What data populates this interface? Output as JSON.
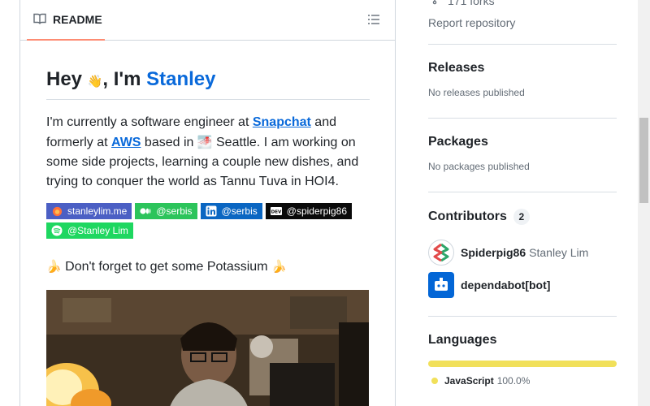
{
  "readme": {
    "tab_label": "README",
    "heading_prefix": "Hey ",
    "heading_emoji": "👋",
    "heading_mid": ", I'm ",
    "heading_name": "Stanley",
    "intro": {
      "t1": "I'm currently a software engineer at ",
      "snapchat": "Snapchat",
      "t2": " and formerly at ",
      "aws": "AWS",
      "t3": " based in ",
      "seattle_emoji": "🌁",
      "t4": " Seattle. I am working on some side projects, learning a couple new dishes, and trying to conquer the world as Tannu Tuva in HOI4."
    },
    "badges": [
      {
        "label": "stanleylim.me",
        "color": "#4b5fc4",
        "icon": "firefox-icon"
      },
      {
        "label": "@serbis",
        "color": "#2cc45b",
        "icon": "medium-icon"
      },
      {
        "label": "@serbis",
        "color": "#0a66c2",
        "icon": "linkedin-icon"
      },
      {
        "label": "@spiderpig86",
        "color": "#0a0a0a",
        "icon": "dev-icon"
      },
      {
        "label": "@Stanley Lim",
        "color": "#1ed760",
        "icon": "spotify-icon"
      }
    ],
    "potassium_emoji": "🍌",
    "potassium_text": " Don't forget to get some Potassium ",
    "potassium_emoji_end": "🍌"
  },
  "sidebar": {
    "forks_text": "171 forks",
    "report_link": "Report repository",
    "releases": {
      "title": "Releases",
      "sub": "No releases published"
    },
    "packages": {
      "title": "Packages",
      "sub": "No packages published"
    },
    "contributors": {
      "title": "Contributors",
      "count": "2",
      "items": [
        {
          "login": "Spiderpig86",
          "name": "Stanley Lim"
        },
        {
          "login": "dependabot[bot]",
          "name": ""
        }
      ]
    },
    "languages": {
      "title": "Languages",
      "items": [
        {
          "name": "JavaScript",
          "pct": "100.0%",
          "color": "#f1e05a",
          "share": 100.0
        }
      ]
    }
  }
}
